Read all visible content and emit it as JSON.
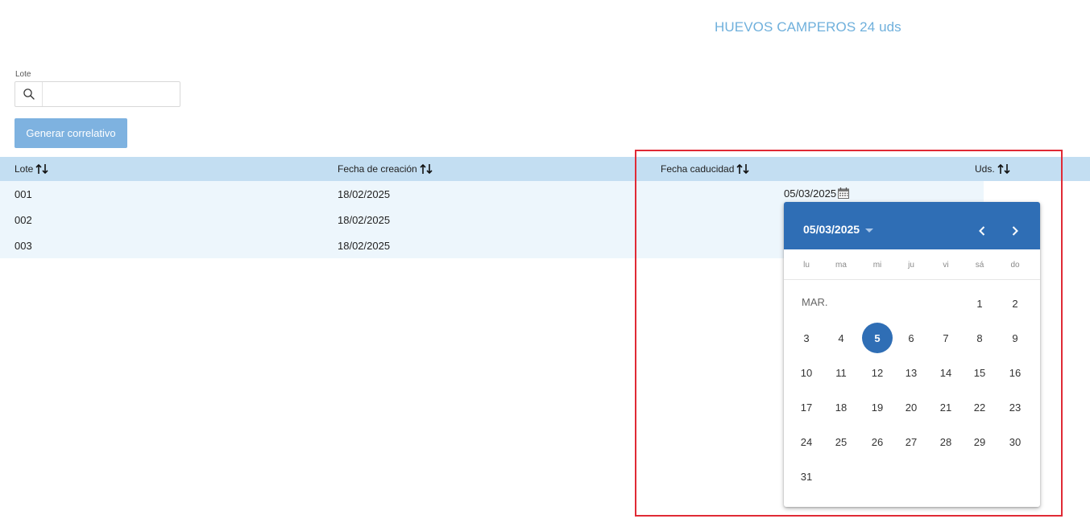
{
  "page": {
    "title": "HUEVOS CAMPEROS 24 uds"
  },
  "filter": {
    "label": "Lote",
    "search_value": "",
    "search_placeholder": ""
  },
  "actions": {
    "generate_label": "Generar correlativo"
  },
  "table": {
    "columns": [
      {
        "label": "Lote"
      },
      {
        "label": "Fecha de creación"
      },
      {
        "label": "Fecha caducidad"
      },
      {
        "label": "Uds."
      }
    ],
    "rows": [
      {
        "lote": "001",
        "creacion": "18/02/2025"
      },
      {
        "lote": "002",
        "creacion": "18/02/2025"
      },
      {
        "lote": "003",
        "creacion": "18/02/2025"
      }
    ]
  },
  "date_editor": {
    "value": "05/03/2025"
  },
  "datepicker": {
    "title": "05/03/2025",
    "weekdays": [
      "lu",
      "ma",
      "mi",
      "ju",
      "vi",
      "sá",
      "do"
    ],
    "month_label": "MAR.",
    "weeks": [
      [
        "",
        "",
        "",
        "",
        "",
        "1",
        "2"
      ],
      [
        "3",
        "4",
        "5",
        "6",
        "7",
        "8",
        "9"
      ],
      [
        "10",
        "11",
        "12",
        "13",
        "14",
        "15",
        "16"
      ],
      [
        "17",
        "18",
        "19",
        "20",
        "21",
        "22",
        "23"
      ],
      [
        "24",
        "25",
        "26",
        "27",
        "28",
        "29",
        "30"
      ],
      [
        "31",
        "",
        "",
        "",
        "",
        "",
        ""
      ]
    ],
    "selected_day": "5"
  },
  "colors": {
    "title": "#6fb0dc",
    "accent": "#2f6eb5",
    "header_row": "#c3def2",
    "data_row": "#edf6fc",
    "highlight": "#e02a35"
  }
}
